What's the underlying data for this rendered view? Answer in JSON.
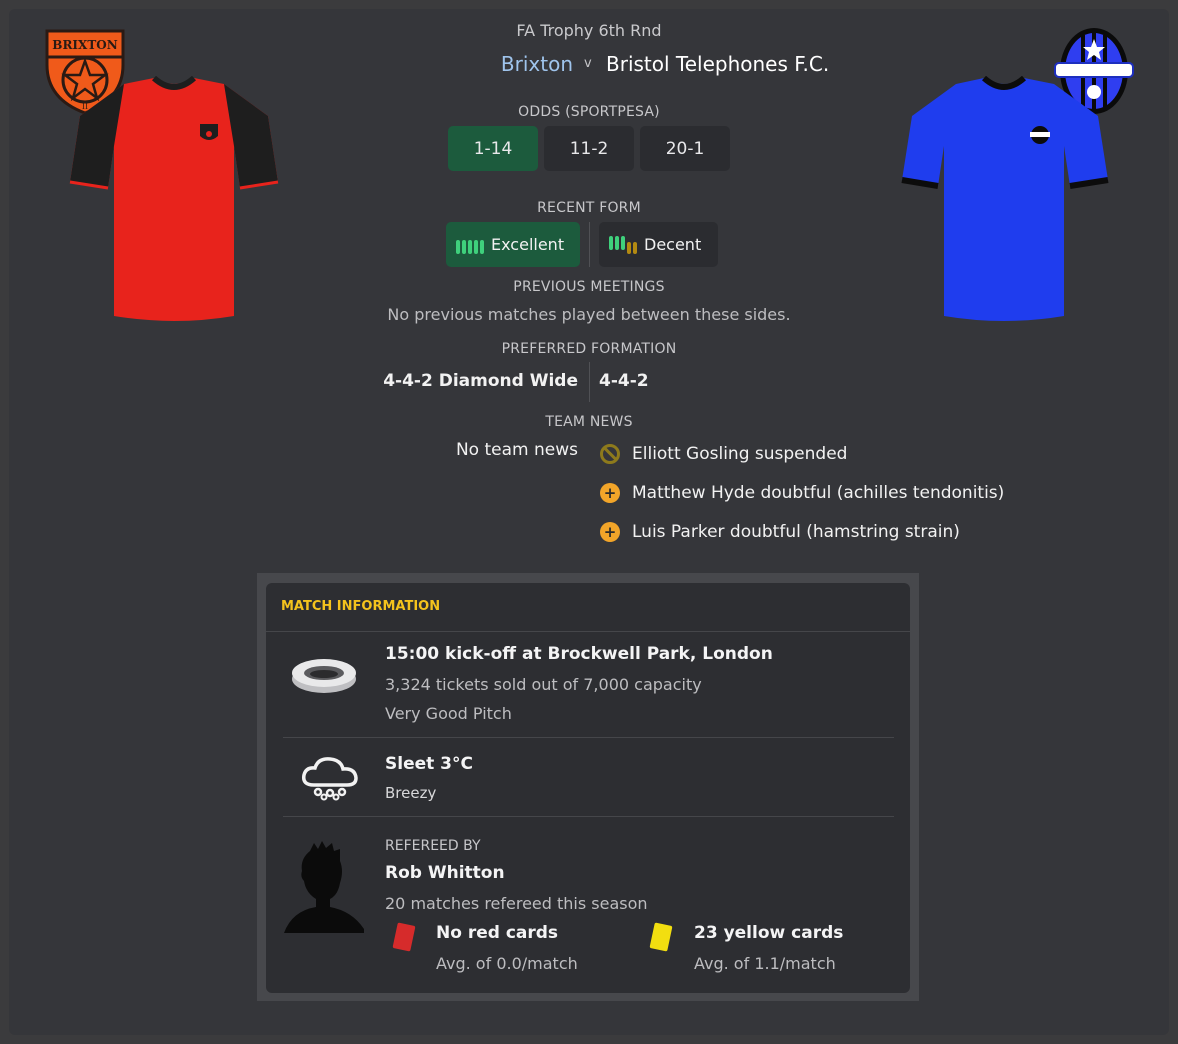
{
  "match": {
    "competition": "FA Trophy 6th Rnd",
    "home_team": "Brixton",
    "vs_label": "v",
    "away_team": "Bristol Telephones F.C."
  },
  "colors": {
    "home_shirt": "#e8231c",
    "home_sleeves": "#1e1e1e",
    "away_shirt": "#1f3dee",
    "accent_green": "#1c5b3d",
    "section_yellow": "#f4c31d",
    "home_link_blue": "#9fc4ec"
  },
  "crests": {
    "home_text_top": "BRIXTON",
    "home_text_bottom": "II"
  },
  "odds": {
    "title": "ODDS (SPORTPESA)",
    "home": "1-14",
    "draw": "11-2",
    "away": "20-1"
  },
  "recent_form": {
    "title": "RECENT FORM",
    "home": "Excellent",
    "away": "Decent"
  },
  "previous_meetings": {
    "title": "PREVIOUS MEETINGS",
    "text": "No previous matches played between these sides."
  },
  "preferred_formation": {
    "title": "PREFERRED FORMATION",
    "home": "4-4-2 Diamond Wide",
    "away": "4-4-2"
  },
  "team_news": {
    "title": "TEAM NEWS",
    "home": "No team news",
    "away": [
      {
        "icon": "suspended-icon",
        "text": "Elliott Gosling suspended"
      },
      {
        "icon": "doubtful-icon",
        "text": "Matthew Hyde doubtful (achilles tendonitis)"
      },
      {
        "icon": "doubtful-icon",
        "text": "Luis Parker doubtful (hamstring strain)"
      }
    ]
  },
  "match_information": {
    "title": "MATCH INFORMATION",
    "venue": {
      "line1": "15:00 kick-off at Brockwell Park, London",
      "line2": "3,324 tickets sold out of 7,000 capacity",
      "line3": "Very Good Pitch"
    },
    "weather": {
      "line1": "Sleet 3°C",
      "line2": "Breezy"
    },
    "referee": {
      "label": "REFEREED BY",
      "name": "Rob Whitton",
      "matches": "20 matches refereed this season",
      "red_cards": "No red cards",
      "red_avg": "Avg. of 0.0/match",
      "yellow_cards": "23 yellow cards",
      "yellow_avg": "Avg. of 1.1/match"
    }
  }
}
